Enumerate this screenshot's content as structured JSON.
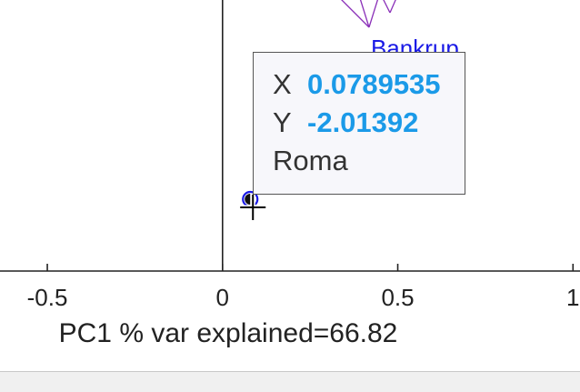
{
  "chart_data": {
    "type": "scatter",
    "xlabel": "PC1 % var explained=66.82",
    "ylabel": "",
    "x_ticks": [
      -0.5,
      0,
      0.5,
      1
    ],
    "x_tick_labels": [
      "-0.5",
      "0",
      "0.5",
      "1"
    ],
    "xlim": [
      -0.635,
      1.02
    ],
    "points": [
      {
        "label": "Roma",
        "x": 0.0789535,
        "y": -2.01392,
        "highlighted": true
      },
      {
        "label": "Bankrup",
        "x": 0.47,
        "y": null
      }
    ],
    "colors": {
      "point": "#1a1ae6",
      "biplot_lines": "#8a2fb8",
      "datatip_value": "#1b9ae8"
    }
  },
  "datatip": {
    "x_key": "X",
    "x_value": "0.0789535",
    "y_key": "Y",
    "y_value": "-2.01392",
    "name": "Roma"
  }
}
